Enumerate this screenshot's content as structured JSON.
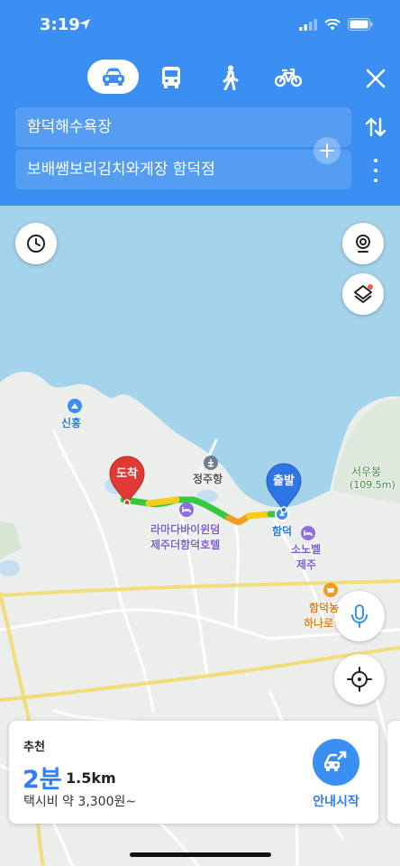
{
  "status_bar": {
    "time": "3:19"
  },
  "transport_modes": [
    {
      "name": "car",
      "icon": "car-icon",
      "selected": true
    },
    {
      "name": "bus",
      "icon": "bus-icon",
      "selected": false
    },
    {
      "name": "walk",
      "icon": "walk-icon",
      "selected": false
    },
    {
      "name": "bike",
      "icon": "bike-icon",
      "selected": false
    }
  ],
  "route": {
    "start": "함덕해수욕장",
    "destination": "보배쌤보리김치와게장 함덕점"
  },
  "map": {
    "places": {
      "sinheung": "신흥",
      "jeongju_port": "정주항",
      "seowubong": "서우봉",
      "seowubong_height": "(109.5m)",
      "hotel_line1": "라마다바이윈덤",
      "hotel_line2": "제주더함덕호텔",
      "hamdeok": "함덕",
      "sonobel_line1": "소노벨",
      "sonobel_line2": "제주",
      "hanaro_line1": "함덕농",
      "hanaro_line2": "하나로"
    },
    "pins": {
      "destination_label": "도착",
      "start_label": "출발"
    },
    "colors": {
      "water": "#a4d3ec",
      "land": "#eceeec",
      "route_green": "#35c93f",
      "route_yellow": "#f6cc20",
      "route_orange": "#f39c1e",
      "pin_red": "#e03a34",
      "pin_blue": "#2f74e6"
    }
  },
  "route_card": {
    "tag": "추천",
    "time": "2분",
    "distance": "1.5km",
    "fare": "택시비 약 3,300원~",
    "start_button": "안내시작"
  }
}
